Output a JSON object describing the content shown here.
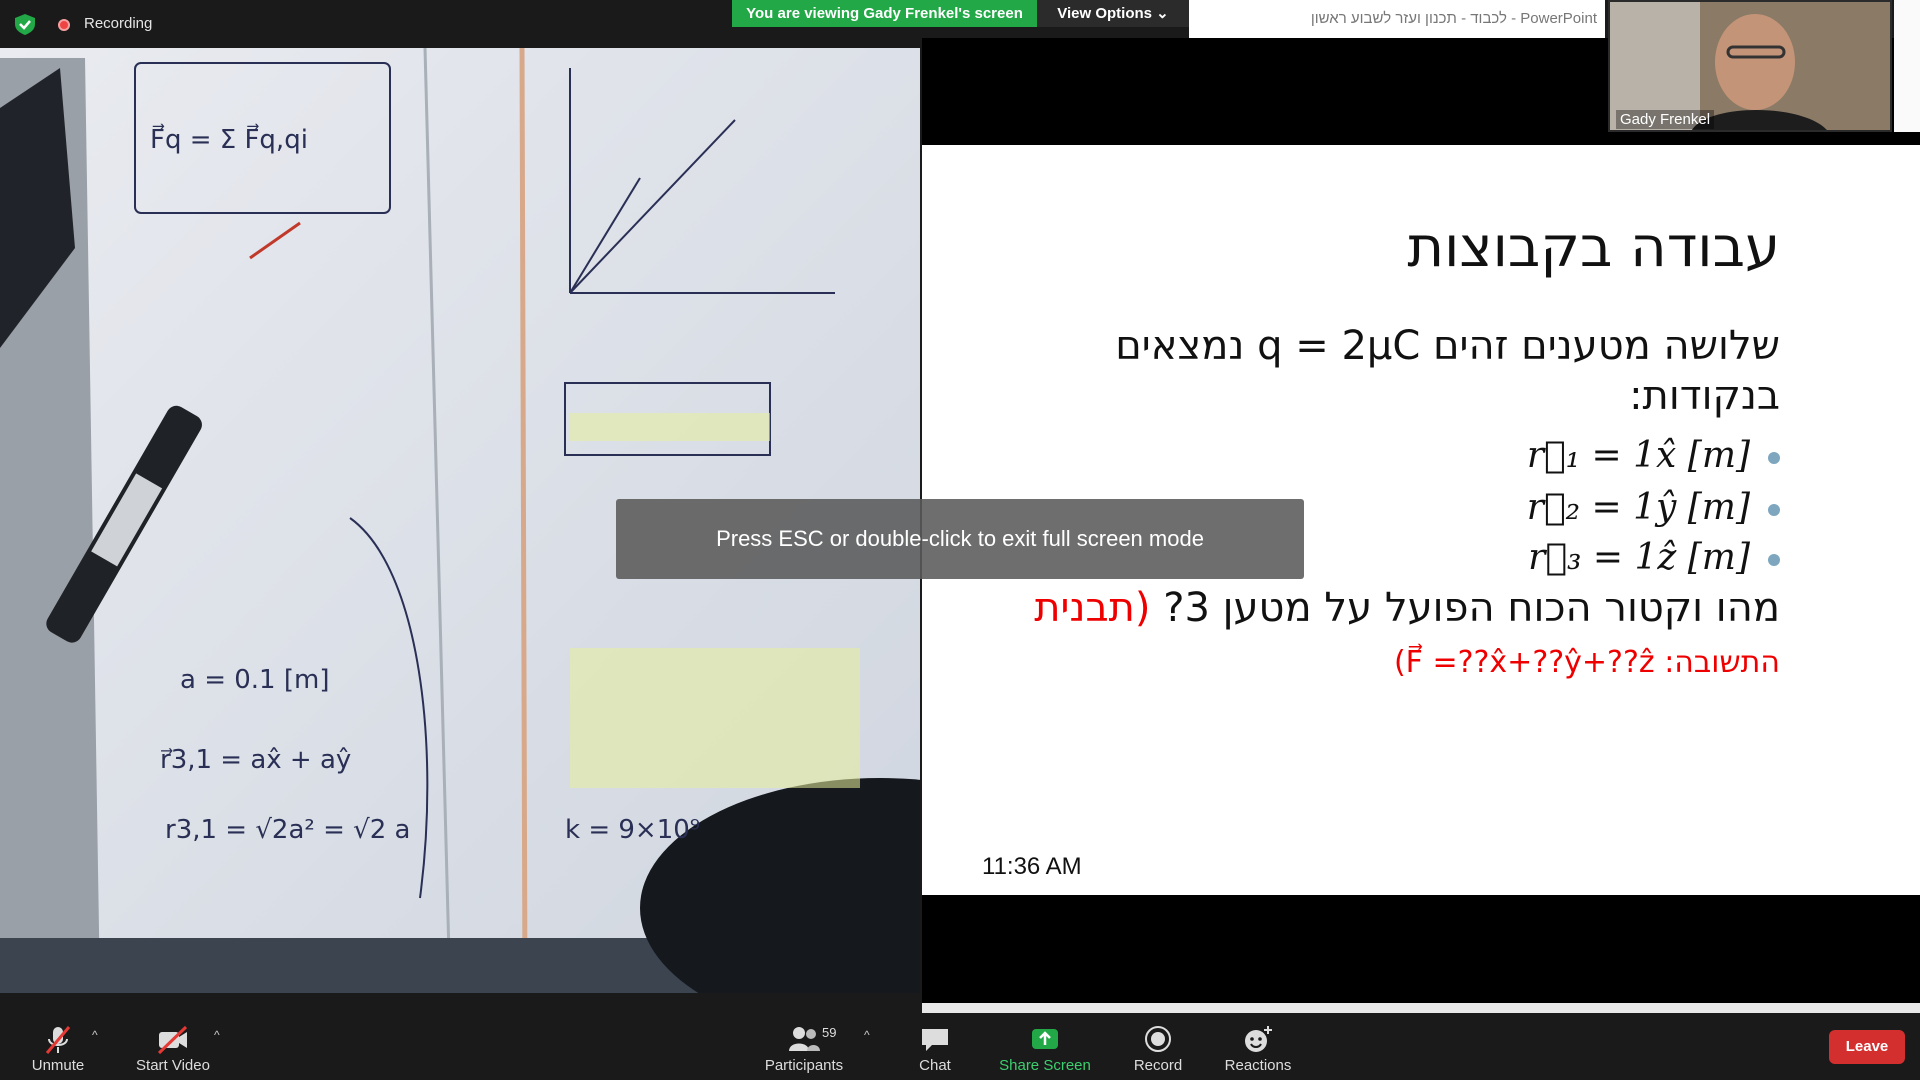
{
  "topbar": {
    "recording_label": "Recording",
    "viewing_banner": "You are viewing Gady Frenkel's screen",
    "view_options_label": "View Options",
    "ppt_window_title": "לכבוד - תכנון ועזר לשבוע ראשון - PowerPoint"
  },
  "self_video": {
    "name": "Gady Frenkel"
  },
  "slide": {
    "title": "עבודה בקבוצות",
    "body_line1": "שלושה מטענים זהים q = 2μC נמצאים בנקודות:",
    "bullets": [
      "r⃗₁ = 1x̂ [m]",
      "r⃗₂ = 1ŷ [m]",
      "r⃗₃ = 1ẑ [m]"
    ],
    "question": "מהו וקטור הכוח הפועל על מטען 3?",
    "question_red": "(תבנית",
    "answer": "התשובה: F⃗ =??x̂+??ŷ+??ẑ)",
    "time": "11:36 AM"
  },
  "toast": {
    "text": "Press ESC or double-click to exit full screen mode"
  },
  "toolbar": {
    "unmute": "Unmute",
    "start_video": "Start Video",
    "participants": "Participants",
    "participants_count": "59",
    "chat": "Chat",
    "share_screen": "Share Screen",
    "record": "Record",
    "reactions": "Reactions",
    "leave": "Leave"
  },
  "colors": {
    "share_green": "#22a846",
    "leave_red": "#d32f2f",
    "recording_red": "#ef4444",
    "slide_red": "#e00000"
  },
  "whiteboard": {
    "notes": [
      "F⃗q = Σ F⃗q,qi",
      "a = 0.1 [m]",
      "k = 9×10⁹",
      "r⃗3,1 = ax̂ + aŷ",
      "r3,1 = √2a² = √2 a"
    ]
  }
}
